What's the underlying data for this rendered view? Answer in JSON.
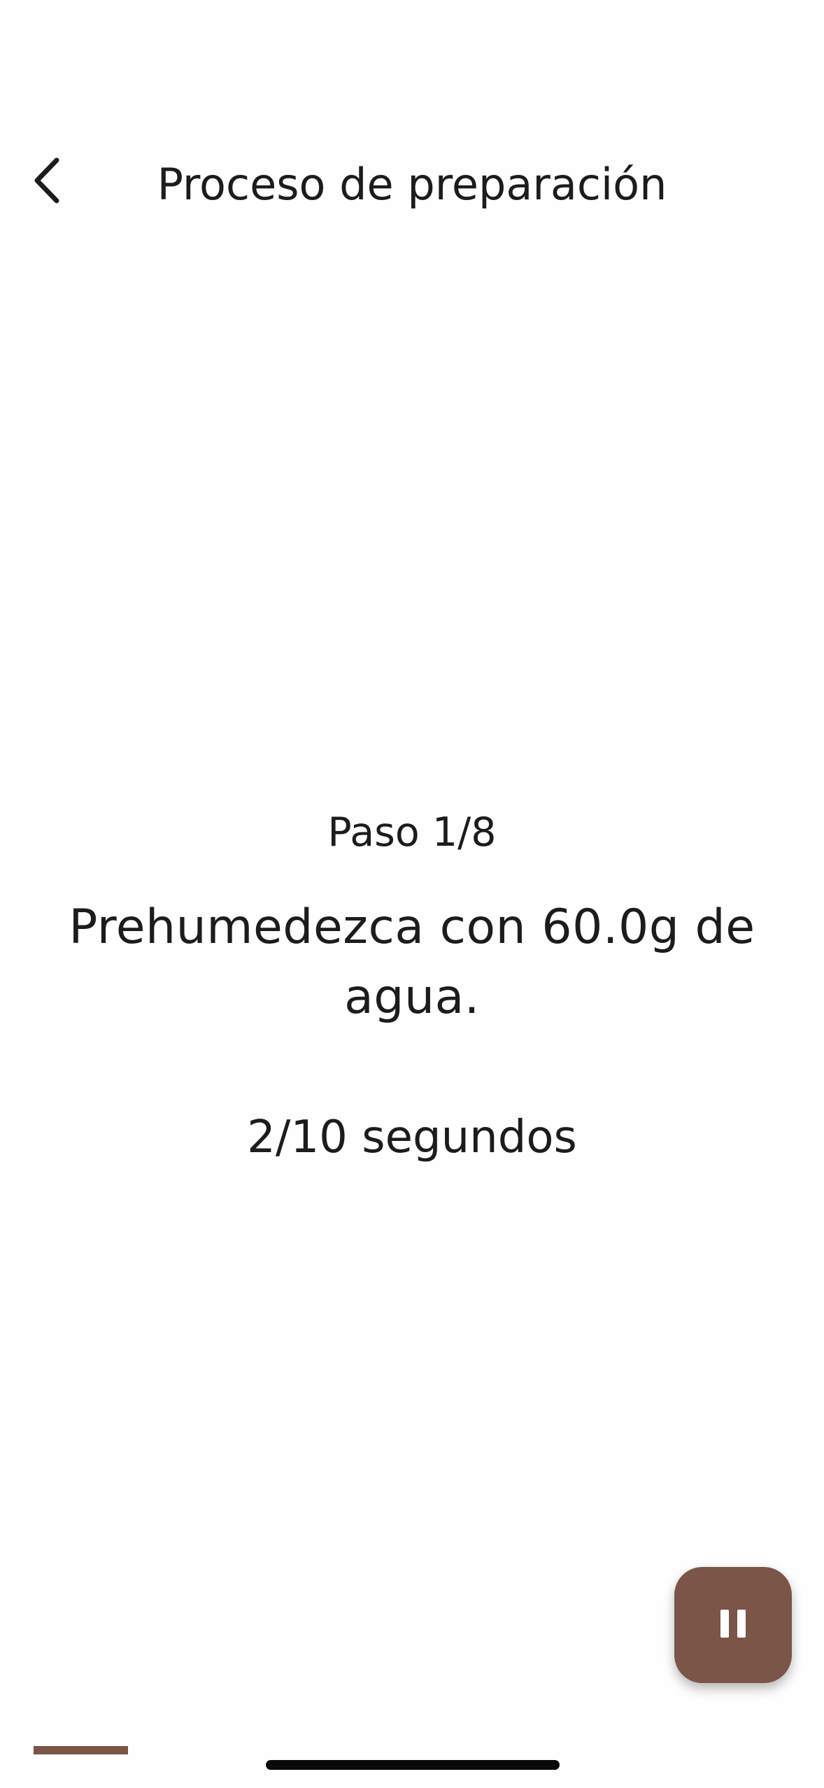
{
  "header": {
    "title": "Proceso de preparación",
    "back_icon": "chevron-left-icon"
  },
  "step": {
    "counter": "Paso 1/8",
    "instruction": "Prehumedezca con 60.0g de agua.",
    "timer": "2/10 segundos"
  },
  "controls": {
    "pause_icon": "pause-icon"
  },
  "progress": {
    "fraction": 0.125,
    "color": "#7a5548"
  },
  "colors": {
    "accent": "#7a5548",
    "background": "#fefefe",
    "text": "#1c1c1c"
  }
}
